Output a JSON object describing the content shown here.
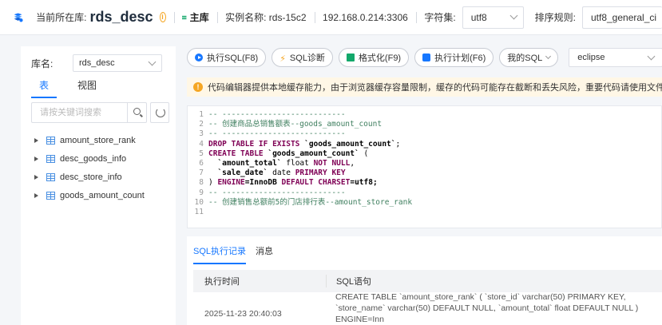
{
  "header": {
    "current_db_label": "当前所在库:",
    "db_name": "rds_desc",
    "master_label": "主库",
    "instance_label": "实例名称: rds-15c2",
    "host": "192.168.0.214:3306",
    "charset_label": "字符集:",
    "charset_value": "utf8",
    "collation_label": "排序规则:",
    "collation_value": "utf8_general_ci"
  },
  "left_panel": {
    "db_label": "库名:",
    "db_select": "rds_desc",
    "tabs": [
      "表",
      "视图"
    ],
    "search_placeholder": "请按关键词搜索",
    "tables": [
      "amount_store_rank",
      "desc_goods_info",
      "desc_store_info",
      "goods_amount_count"
    ]
  },
  "toolbar": {
    "run": "执行SQL(F8)",
    "diagnose": "SQL诊断",
    "format": "格式化(F9)",
    "plan": "执行计划(F6)",
    "my_sql": "我的SQL",
    "theme": "eclipse"
  },
  "warning": "代码编辑器提供本地缓存能力，由于浏览器缓存容量限制，缓存的代码可能存在截断和丢失风险，重要代码请使用文件保存。",
  "editor": {
    "line_numbers": [
      "1",
      "2",
      "3",
      "4",
      "5",
      "6",
      "7",
      "8",
      "9",
      "10",
      "11"
    ],
    "l1": "-- ---------------------------",
    "l2": "-- 创建商品总销售额表--goods_amount_count",
    "l3": "-- ---------------------------",
    "l4_kw": "DROP TABLE IF EXISTS ",
    "l4_name": "`goods_amount_count`",
    "l4_end": ";",
    "l5_kw": "CREATE TABLE ",
    "l5_name": "`goods_amount_count`",
    "l5_end": " (",
    "l6_col": "`amount_total`",
    "l6_type": " float ",
    "l6_kw": "NOT NULL",
    "l6_end": ",",
    "l7_col": "`sale_date`",
    "l7_type": " date ",
    "l7_kw": "PRIMARY KEY",
    "l8_a": ") ",
    "l8_kw1": "ENGINE",
    "l8_b": "=InnoDB ",
    "l8_kw2": "DEFAULT CHARSET",
    "l8_c": "=utf8;",
    "l9": "-- ---------------------------",
    "l10": "-- 创建销售总额前5的门店排行表--amount_store_rank",
    "l11": ""
  },
  "results": {
    "tabs": [
      "SQL执行记录",
      "消息"
    ],
    "columns": [
      "执行时间",
      "SQL语句"
    ],
    "rows": [
      {
        "time": "2025-11-23 20:40:03",
        "sql": "CREATE TABLE `amount_store_rank` ( `store_id` varchar(50) PRIMARY KEY, `store_name` varchar(50) DEFAULT NULL, `amount_total` float DEFAULT NULL ) ENGINE=Inn"
      }
    ]
  },
  "colors": {
    "accent": "#1677ff",
    "warning": "#f5a623",
    "comment": "#3f7f5f",
    "keyword": "#7f0055"
  }
}
